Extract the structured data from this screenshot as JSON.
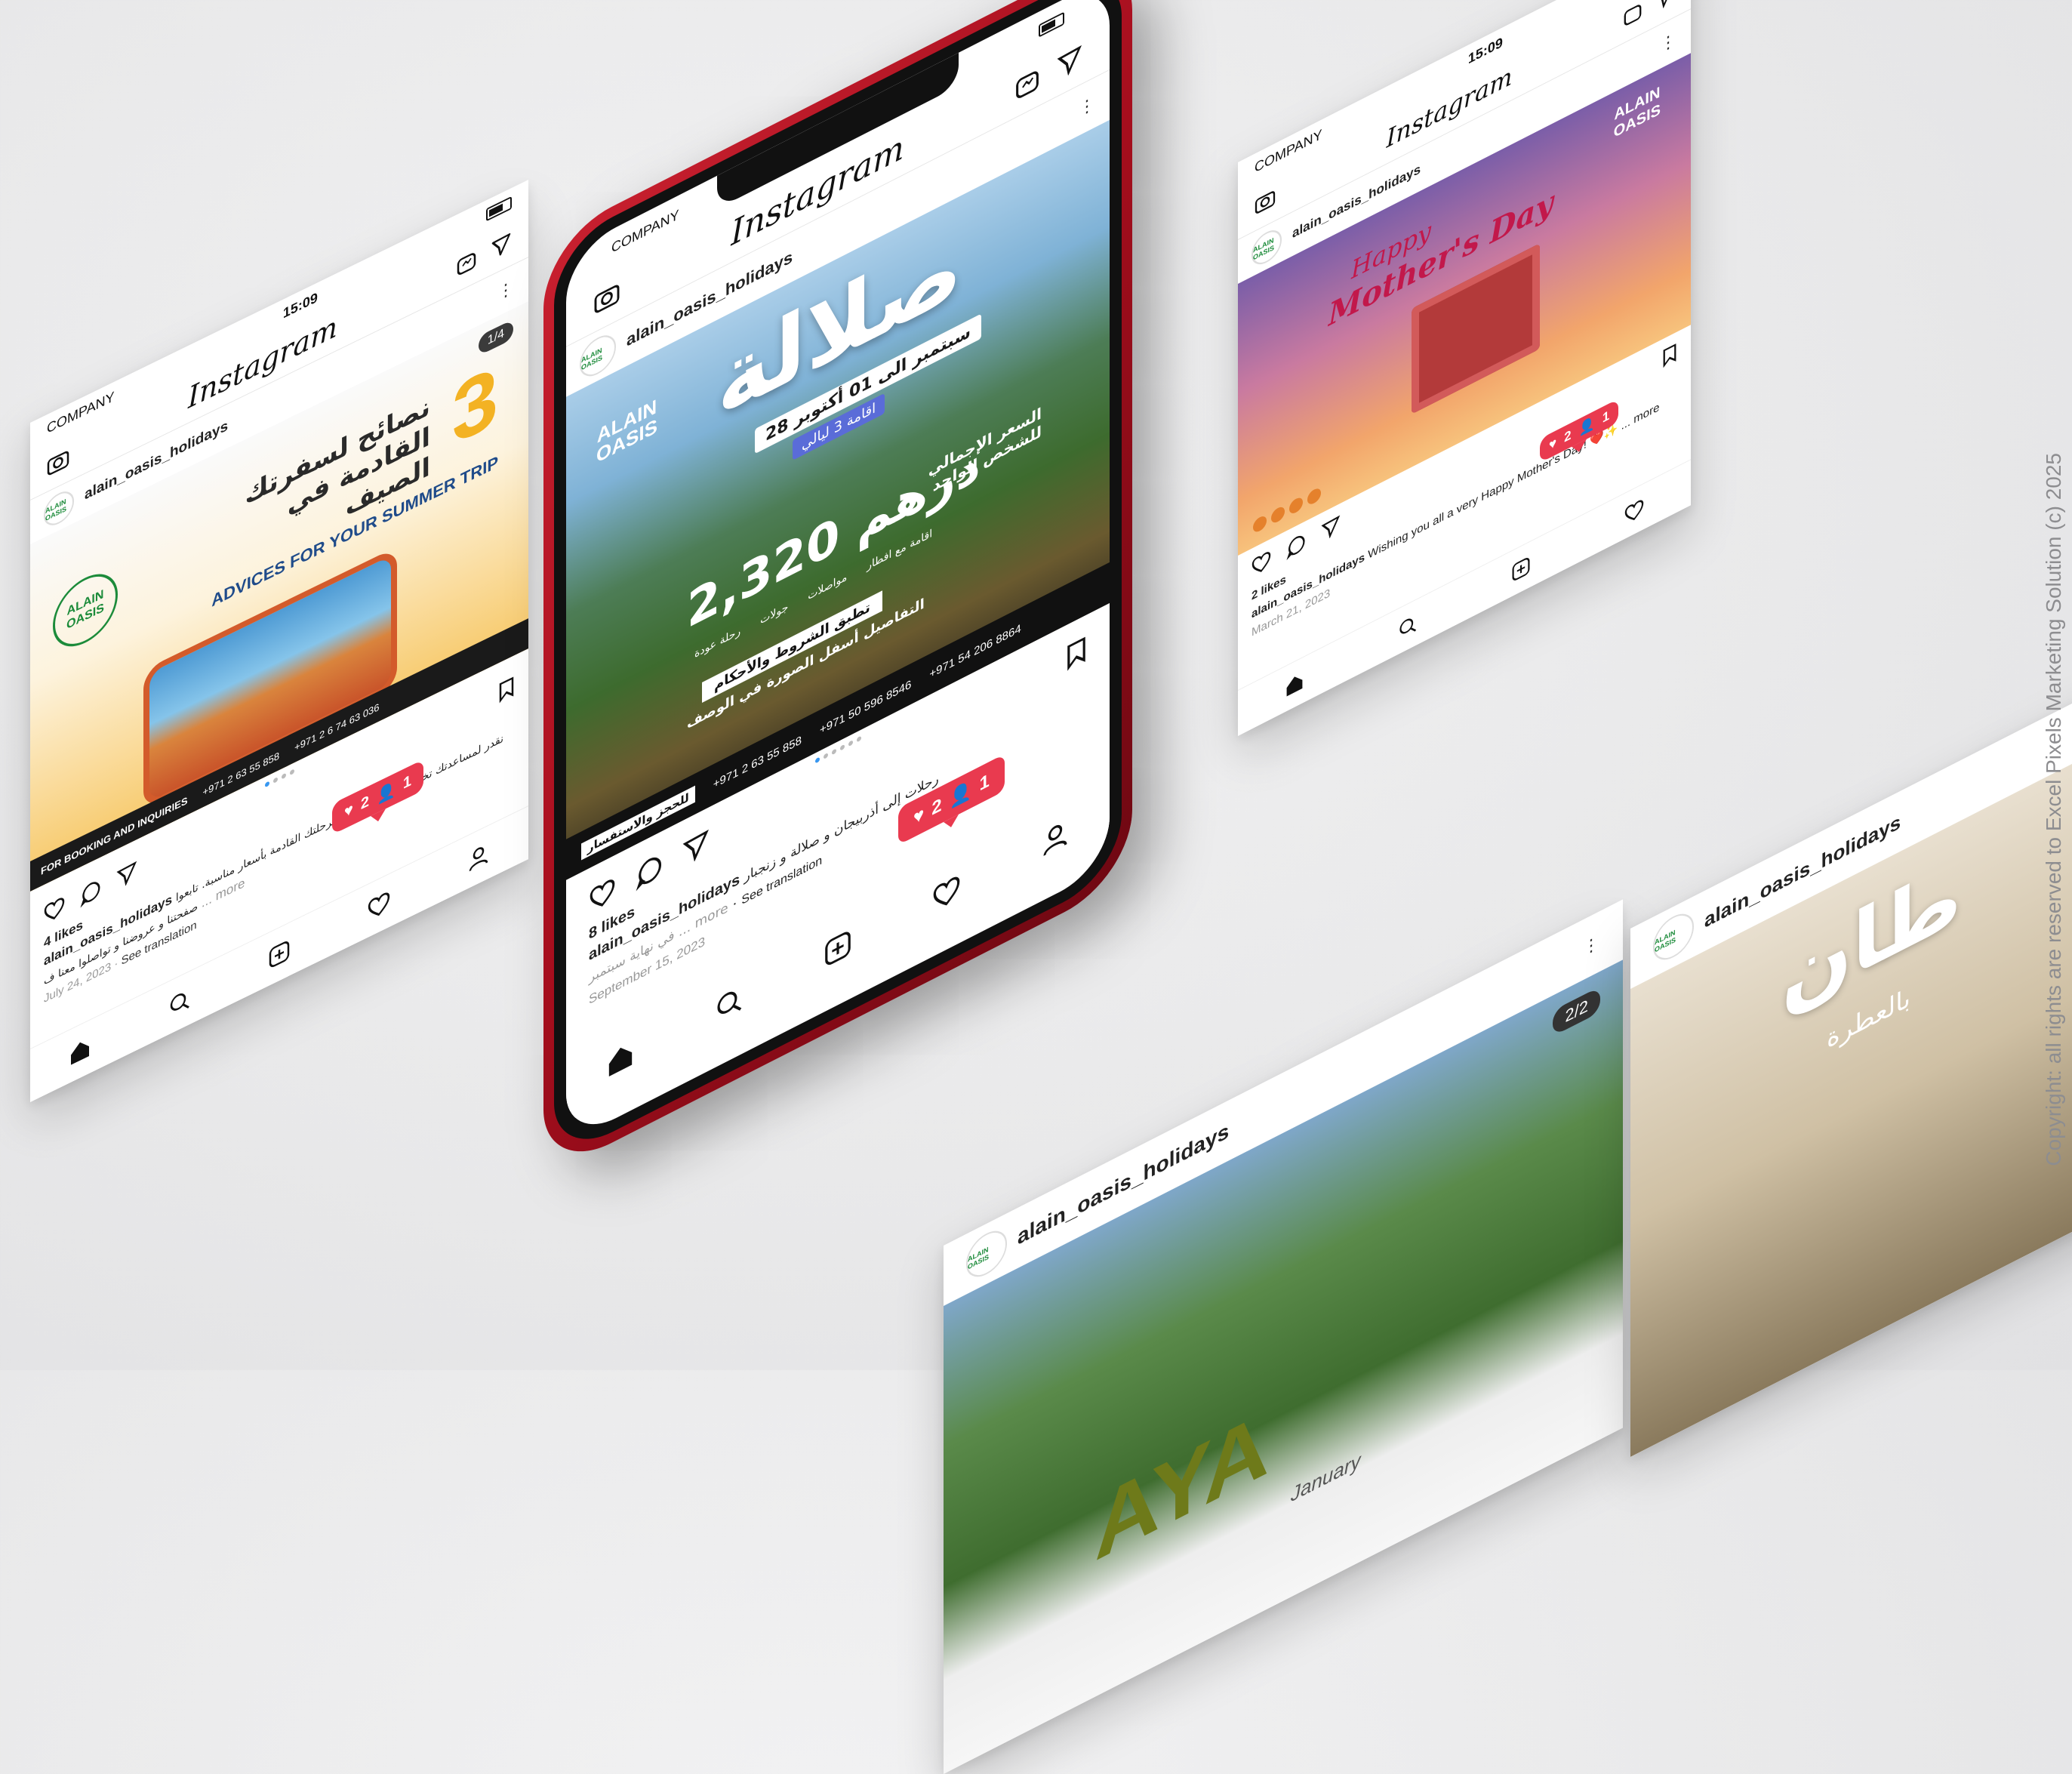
{
  "status": {
    "carrier": "COMPANY",
    "time": "15:09"
  },
  "app": {
    "name": "Instagram"
  },
  "account": {
    "handle": "alain_oasis_holidays",
    "avatar_text": "ALAIN OASIS"
  },
  "center_post": {
    "headline": "صلالة",
    "dates": "28 سبتمبر الى 01 أكتوبر",
    "nights": "اقامة 3 ليالي",
    "price": "2,320 درهم",
    "price_label": "السعر الإجمالي للشخص الواحد",
    "features": [
      "رحلة عودة",
      "جولات",
      "مواصلات",
      "اقامة مع افطار"
    ],
    "terms": "تطبق الشروط والأحكام",
    "details": "التفاصيل أسفل الصورة في الوصف",
    "phone1": "+971 2 63 55 858",
    "phone2": "+971 50 596 8546",
    "whatsapp": "+971 54 206 8864",
    "booking_tag": "للحجز والاستفسار",
    "likes": "8 likes",
    "caption": "رحلات إلى أذربيجان و صلالة و زنجبار",
    "caption_more": "في نهاية سبتمبر ... more",
    "translate": "See translation",
    "date": "September 15, 2023",
    "notif_likes": "2",
    "notif_followers": "1"
  },
  "left_post": {
    "counter": "1/4",
    "headline_num": "3",
    "headline_ar": "نصائح لسفرتك القادمة في الصيف",
    "headline_en": "ADVICES FOR YOUR SUMMER TRIP",
    "booking_tag": "FOR BOOKING AND INQUIRIES",
    "phone1": "+971 2 63 55 858",
    "phone2": "+971 2 6 74 63 036",
    "likes": "4 likes",
    "caption": "نقدر لمساعدتك تختار وجهتك و تخطط لرحلتك القادمة بأسعار مناسبة. تابعوا صفحتنا و عروضنا و تواصلوا معنا ف",
    "caption_more": "... more",
    "translate": "See translation",
    "date": "July 24, 2023",
    "notif_likes": "2",
    "notif_followers": "1"
  },
  "right_post": {
    "headline_small": "Happy",
    "headline": "Mother's Day",
    "likes": "2 likes",
    "caption": "Wishing you all a very Happy Mother's Day! ❤️✨ ... more",
    "date": "March 21, 2023",
    "notif_likes": "2",
    "notif_followers": "1"
  },
  "bottom_post": {
    "counter": "2/2",
    "headline": "AYA",
    "subline": "January"
  },
  "edge_post": {
    "headline": "طان",
    "subline": "بالعطرة"
  },
  "watermark": "Copyright: all rights are reserved to Excel Pixels Marketing Solution (c) 2025",
  "colors": {
    "notification": "#e93a4f",
    "phone_frame": "#a50e1d",
    "brand_green": "#1c8b3a",
    "brand_gold": "#f3b223"
  },
  "icons": [
    "camera-icon",
    "igtv-icon",
    "send-icon",
    "heart-icon",
    "comment-icon",
    "bookmark-icon",
    "home-icon",
    "search-icon",
    "add-icon",
    "profile-icon",
    "more-dots-icon"
  ]
}
